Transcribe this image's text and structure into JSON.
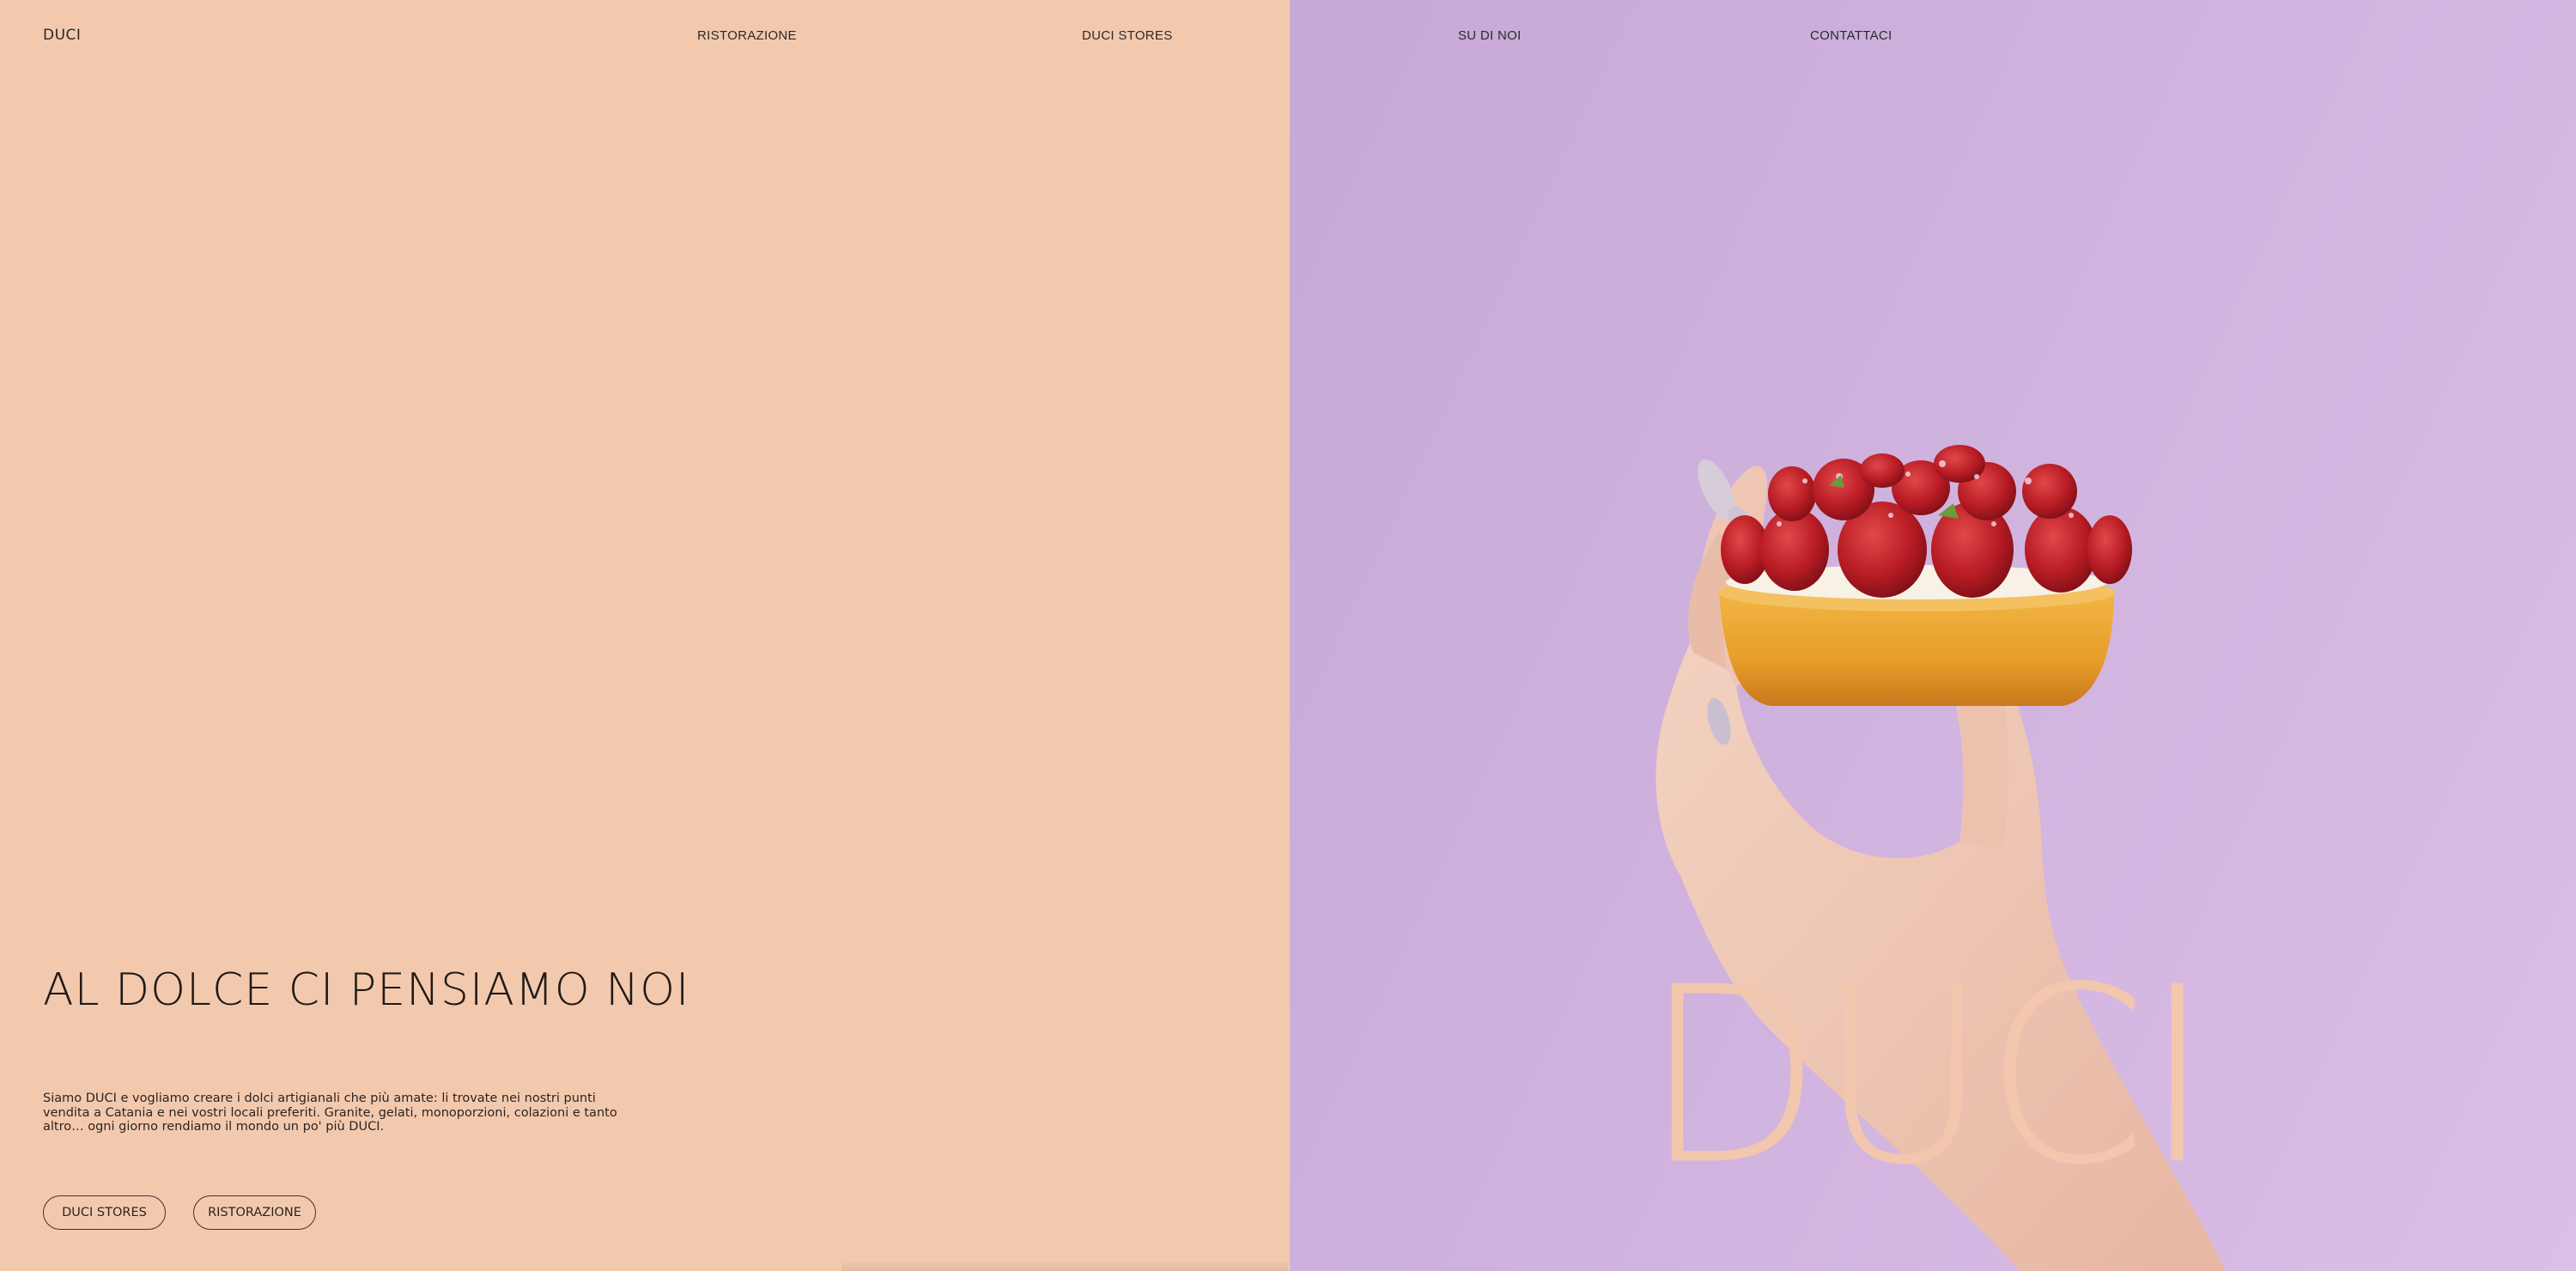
{
  "nav": {
    "logo": "DUCI",
    "items": [
      "RISTORAZIONE",
      "DUCI STORES",
      "SU DI NOI",
      "CONTATTACI"
    ]
  },
  "hero": {
    "headline": "AL DOLCE CI PENSIAMO NOI",
    "intro": "Siamo DUCI e vogliamo creare i dolci artigianali che più amate: li trovate nei nostri punti vendita a Catania e nei vostri locali preferiti. Granite, gelati, monoporzioni, colazioni e tanto altro… ogni giorno rendiamo il mondo un po' più DUCI.",
    "buttons": [
      "DUCI STORES",
      "RISTORAZIONE"
    ]
  },
  "feature": {
    "wordmark": "DUCI",
    "image_subject": "hand holding strawberry tart"
  },
  "colors": {
    "left_bg": "#f3c9ae",
    "right_bg": "#d2b4e0",
    "wordmark": "#f2c7ad",
    "text": "#1f1a17"
  }
}
